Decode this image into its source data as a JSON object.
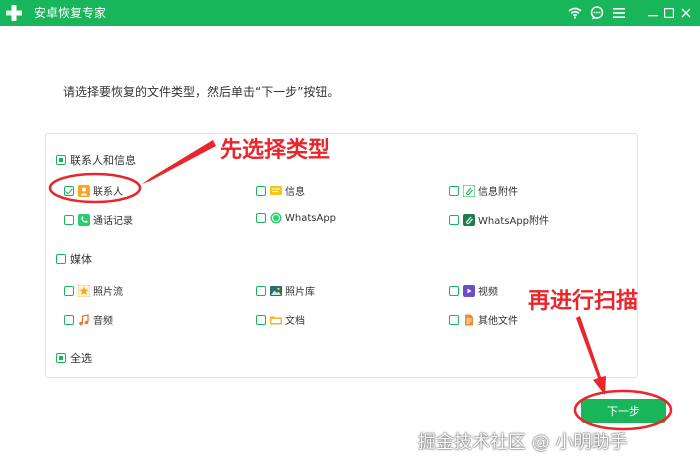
{
  "window": {
    "title": "安卓恢复专家",
    "accent": "#19b55a"
  },
  "instruction": "请选择要恢复的文件类型，然后单击“下一步”按钮。",
  "groups": {
    "contacts_messages": {
      "label": "联系人和信息",
      "items": {
        "contacts": {
          "label": "联系人",
          "checked": true,
          "icon": "contact-icon"
        },
        "messages": {
          "label": "信息",
          "checked": false,
          "icon": "message-icon"
        },
        "message_attachments": {
          "label": "信息附件",
          "checked": false,
          "icon": "attachment-icon"
        },
        "call_log": {
          "label": "通话记录",
          "checked": false,
          "icon": "phone-icon"
        },
        "whatsapp": {
          "label": "WhatsApp",
          "checked": false,
          "icon": "whatsapp-icon"
        },
        "whatsapp_attachments": {
          "label": "WhatsApp附件",
          "checked": false,
          "icon": "whatsapp-attachment-icon"
        }
      }
    },
    "media": {
      "label": "媒体",
      "items": {
        "photo_stream": {
          "label": "照片流",
          "checked": false,
          "icon": "star-photo-icon"
        },
        "photo_library": {
          "label": "照片库",
          "checked": false,
          "icon": "picture-icon"
        },
        "video": {
          "label": "视频",
          "checked": false,
          "icon": "video-icon"
        },
        "audio": {
          "label": "音频",
          "checked": false,
          "icon": "music-icon"
        },
        "documents": {
          "label": "文档",
          "checked": false,
          "icon": "folder-icon"
        },
        "other_files": {
          "label": "其他文件",
          "checked": false,
          "icon": "file-icon"
        }
      }
    }
  },
  "select_all": {
    "label": "全选",
    "state": "partial"
  },
  "next_button": {
    "label": "下一步"
  },
  "annotations": {
    "select_type": "先选择类型",
    "then_scan": "再进行扫描"
  },
  "watermark": "掘金技术社区 @ 小明助手"
}
